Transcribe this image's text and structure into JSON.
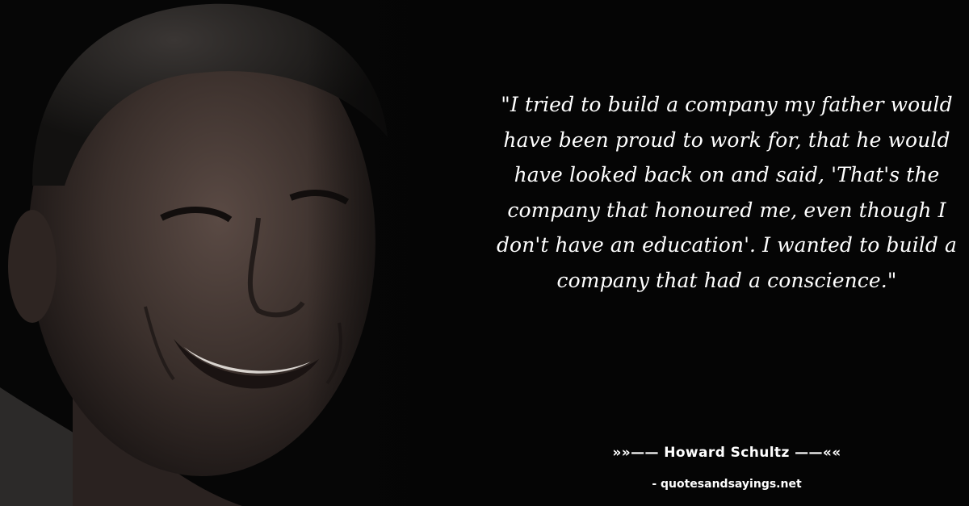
{
  "quote": {
    "text": "\"I tried to build a company my father would have been proud to work for, that he would have looked back on and said, 'That's the company that honoured me, even though I don't have an education'. I wanted to build a company that had a conscience.\""
  },
  "attribution": {
    "author": "»»—— Howard Schultz ——««",
    "source": "- quotesandsayings.net"
  },
  "colors": {
    "background": "#050505",
    "text": "#ffffff"
  }
}
